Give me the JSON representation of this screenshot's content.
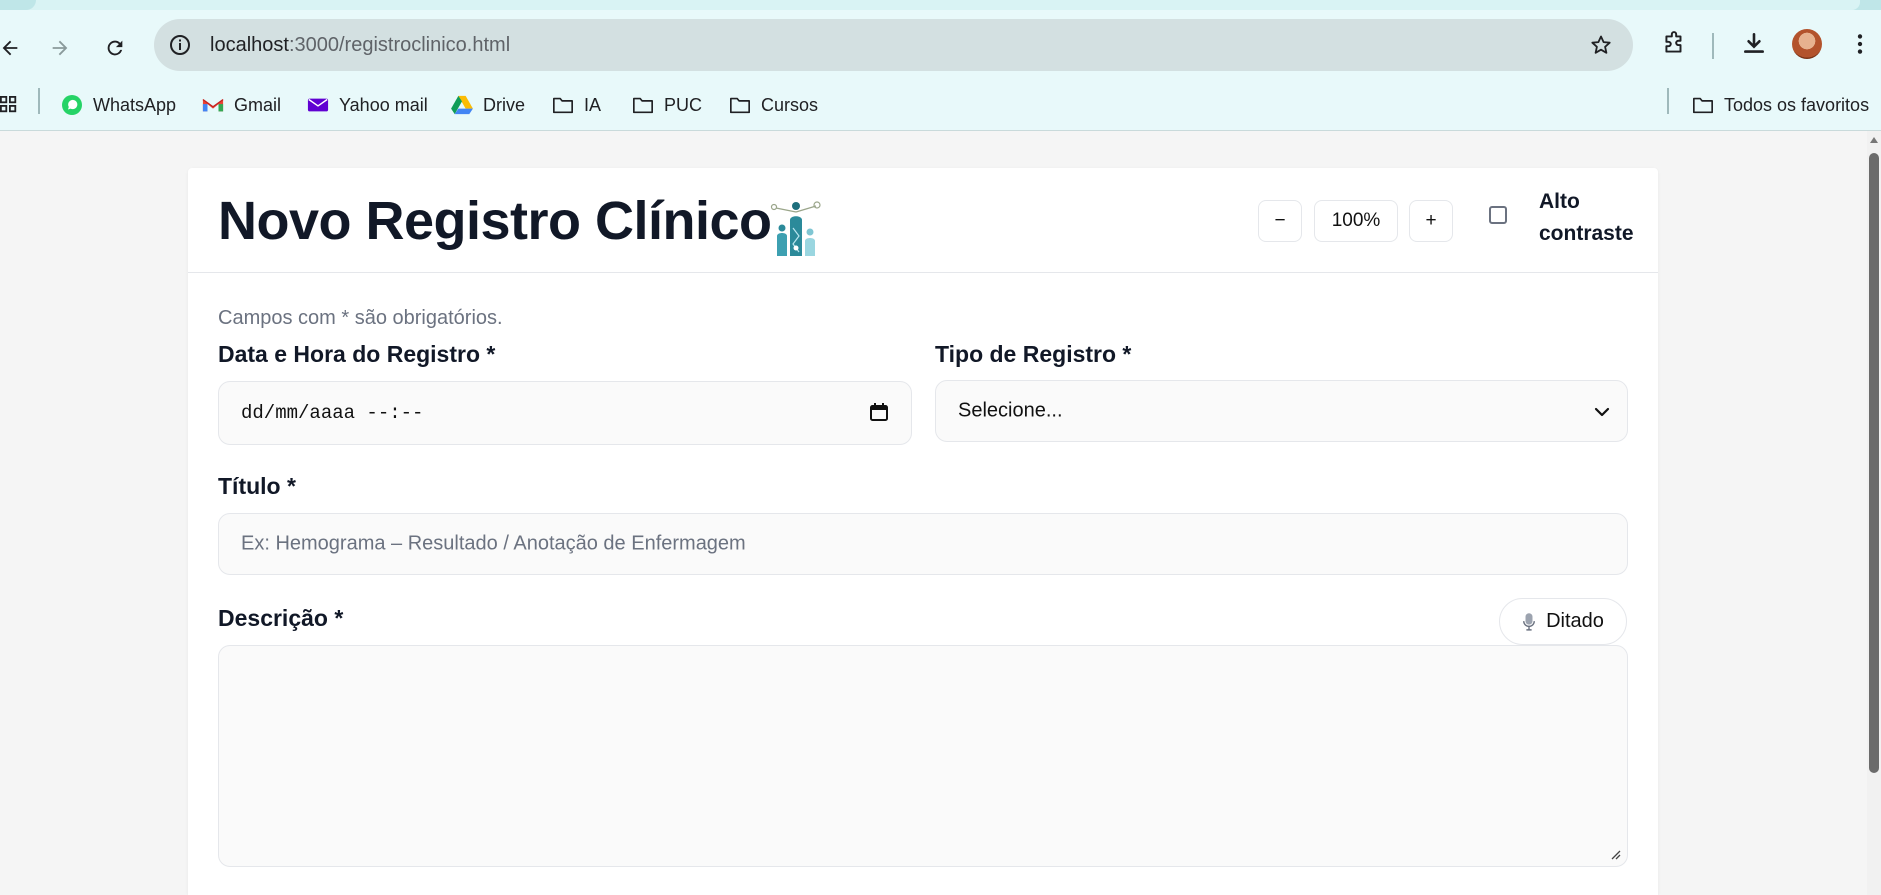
{
  "browser": {
    "url_host": "localhost",
    "url_path": ":3000/registroclinico.html",
    "bookmarks": [
      {
        "label": "WhatsApp",
        "icon": "whatsapp-icon"
      },
      {
        "label": "Gmail",
        "icon": "gmail-icon"
      },
      {
        "label": "Yahoo mail",
        "icon": "yahoo-mail-icon"
      },
      {
        "label": "Drive",
        "icon": "drive-icon"
      },
      {
        "label": "IA",
        "icon": "folder-icon"
      },
      {
        "label": "PUC",
        "icon": "folder-icon"
      },
      {
        "label": "Cursos",
        "icon": "folder-icon"
      }
    ],
    "all_bookmarks_label": "Todos os favoritos"
  },
  "header": {
    "title": "Novo Registro Clínico",
    "zoom_out_label": "−",
    "zoom_value": "100%",
    "zoom_in_label": "+",
    "high_contrast_label": "Alto contraste",
    "high_contrast_checked": false
  },
  "form": {
    "required_hint": "Campos com * são obrigatórios.",
    "datetime": {
      "label": "Data e Hora do Registro *",
      "value": "dd/mm/aaaa --:--"
    },
    "type": {
      "label": "Tipo de Registro *",
      "selected": "Selecione..."
    },
    "title": {
      "label": "Título *",
      "placeholder": "Ex: Hemograma – Resultado / Anotação de Enfermagem"
    },
    "description": {
      "label": "Descrição *",
      "value": "",
      "dictate_label": "Ditado"
    }
  },
  "colors": {
    "accent_logo": "#2b8a9a",
    "toolbar_bg": "#e8f9fa",
    "page_bg": "#f5f5f5"
  }
}
